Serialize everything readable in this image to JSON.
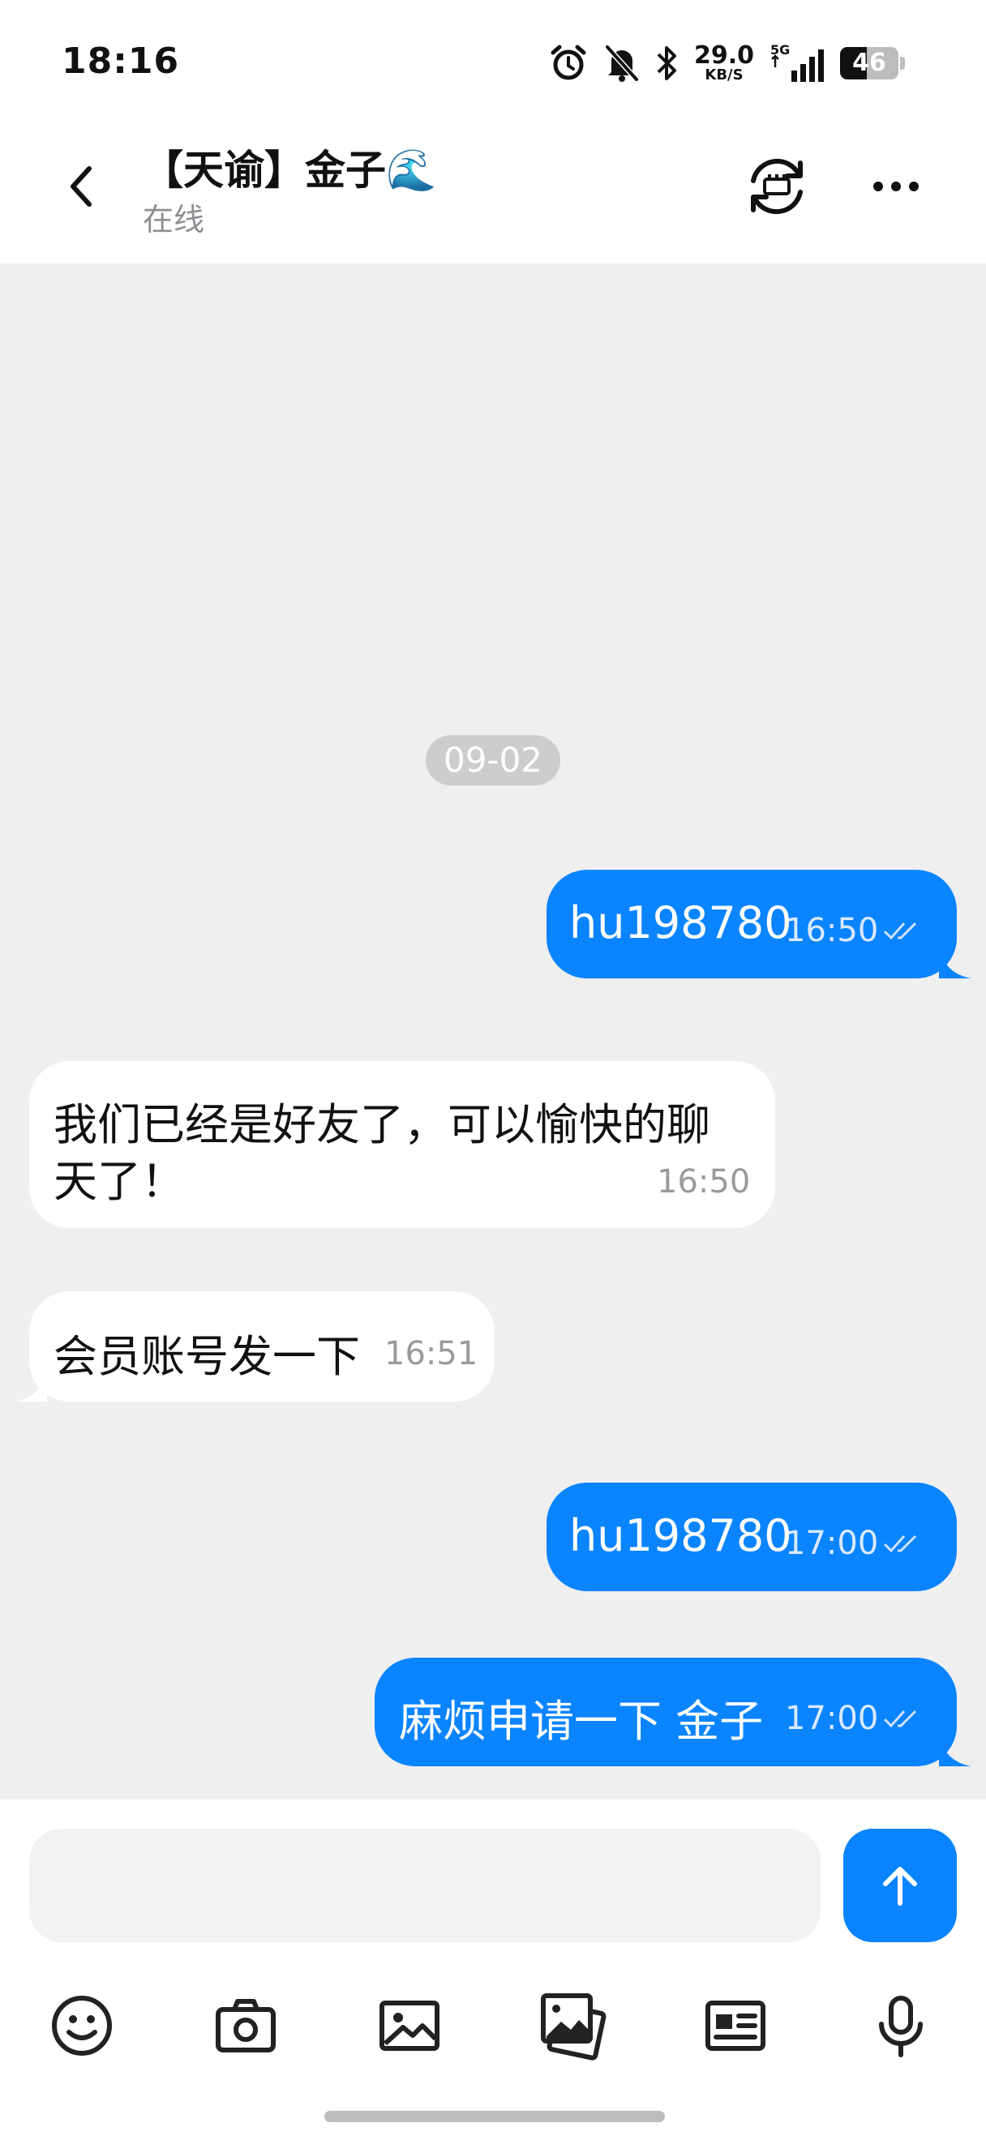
{
  "status_bar": {
    "time": "18:16",
    "net_speed_value": "29.0",
    "net_speed_unit": "KB/S",
    "network_label": "5G",
    "battery_level": "46",
    "icons": [
      "alarm-icon",
      "mute-bell-icon",
      "bluetooth-icon",
      "signal-icon",
      "battery-icon"
    ]
  },
  "header": {
    "contact_name": "【天谕】金子🌊",
    "status": "在线",
    "icons": [
      "back-arrow-icon",
      "sync-icon",
      "more-icon"
    ]
  },
  "chat": {
    "date_separator": "09-02",
    "messages": [
      {
        "direction": "out",
        "text": "hu198780",
        "time": "16:50",
        "read": true
      },
      {
        "direction": "in",
        "text_line1": "我们已经是好友了，可以愉快的聊",
        "text_line2": "天了！",
        "time": "16:50"
      },
      {
        "direction": "in",
        "text": "会员账号发一下",
        "time": "16:51"
      },
      {
        "direction": "out",
        "text": "hu198780",
        "time": "17:00",
        "read": true
      },
      {
        "direction": "out",
        "text": "麻烦申请一下 金子",
        "time": "17:00",
        "read": true
      }
    ]
  },
  "composer": {
    "input_value": "",
    "input_placeholder": "",
    "send_icon": "arrow-up-icon",
    "tools": [
      "emoji-icon",
      "camera-icon",
      "image-icon",
      "gallery-icon",
      "contact-card-icon",
      "microphone-icon"
    ]
  },
  "colors": {
    "accent": "#0a84ff",
    "chat_background": "#efeff0",
    "incoming_bubble": "#ffffff",
    "secondary_text": "#8e8e93"
  }
}
